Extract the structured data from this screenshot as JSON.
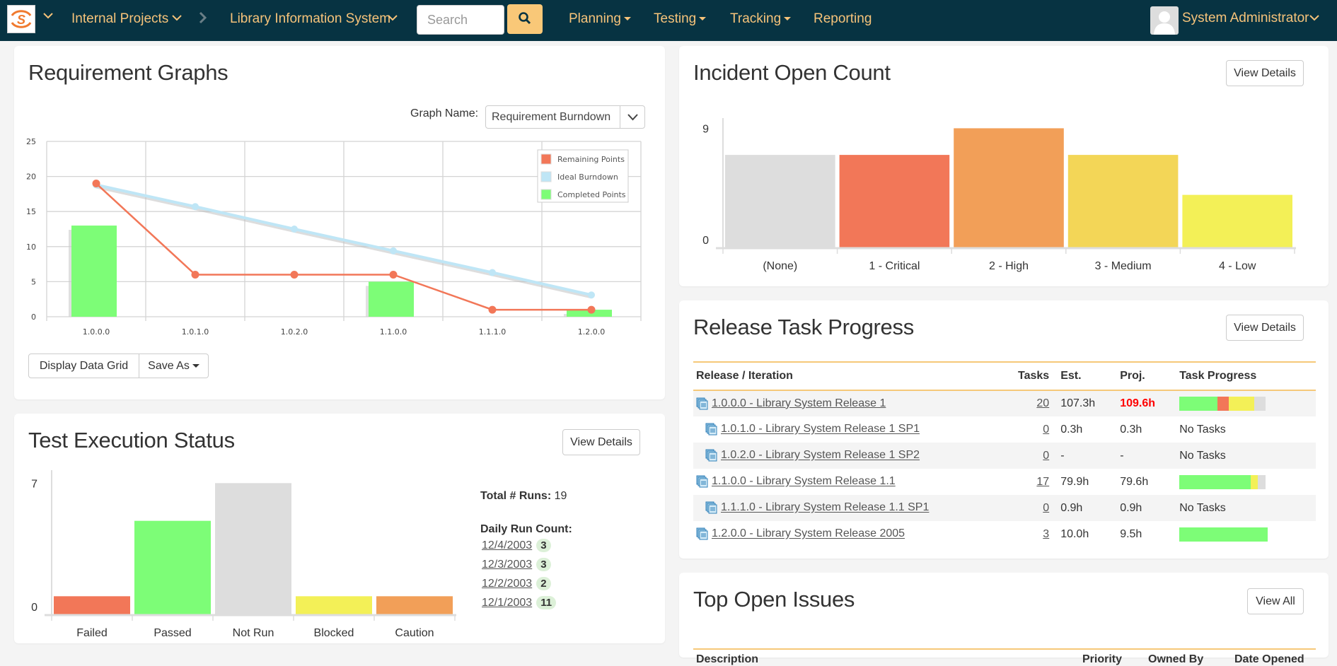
{
  "nav": {
    "project_group": "Internal Projects",
    "project": "Library Information System",
    "search_placeholder": "Search",
    "menu": [
      "Planning",
      "Testing",
      "Tracking",
      "Reporting"
    ],
    "user": "System Administrator"
  },
  "requirement_graphs": {
    "title": "Requirement Graphs",
    "graph_name_label": "Graph Name:",
    "graph_name_value": "Requirement Burndown",
    "display_grid_label": "Display Data Grid",
    "save_as_label": "Save As"
  },
  "incident_panel": {
    "title": "Incident Open Count",
    "view_details": "View Details"
  },
  "test_exec": {
    "title": "Test Execution Status",
    "view_details": "View Details",
    "total_runs_label": "Total # Runs:",
    "total_runs_value": "19",
    "daily_label": "Daily Run Count:",
    "daily": [
      {
        "date": "12/4/2003",
        "count": "3"
      },
      {
        "date": "12/3/2003",
        "count": "3"
      },
      {
        "date": "12/2/2003",
        "count": "2"
      },
      {
        "date": "12/1/2003",
        "count": "11"
      }
    ]
  },
  "release_progress": {
    "title": "Release Task Progress",
    "view_details": "View Details",
    "columns": [
      "Release / Iteration",
      "Tasks",
      "Est.",
      "Proj.",
      "Task Progress"
    ],
    "rows": [
      {
        "name": "1.0.0.0 - Library System Release 1",
        "indent": false,
        "tasks": "20",
        "est": "107.3h",
        "proj": "109.6h",
        "proj_overrun": true,
        "progress": {
          "completed": 44,
          "late": 13,
          "in_progress": 30,
          "not_started": 13
        }
      },
      {
        "name": "1.0.1.0 - Library System Release 1 SP1",
        "indent": true,
        "tasks": "0",
        "est": "0.3h",
        "proj": "0.3h",
        "no_tasks": "No Tasks"
      },
      {
        "name": "1.0.2.0 - Library System Release 1 SP2",
        "indent": true,
        "tasks": "0",
        "est": "-",
        "proj": "-",
        "no_tasks": "No Tasks"
      },
      {
        "name": "1.1.0.0 - Library System Release 1.1",
        "indent": false,
        "tasks": "17",
        "est": "79.9h",
        "proj": "79.6h",
        "progress": {
          "completed": 83,
          "late": 0,
          "in_progress": 8,
          "not_started": 9
        }
      },
      {
        "name": "1.1.1.0 - Library System Release 1.1 SP1",
        "indent": true,
        "tasks": "0",
        "est": "0.9h",
        "proj": "0.9h",
        "no_tasks": "No Tasks"
      },
      {
        "name": "1.2.0.0 - Library System Release 2005",
        "indent": false,
        "tasks": "3",
        "est": "10.0h",
        "proj": "9.5h",
        "progress": {
          "completed": 100,
          "late": 0,
          "in_progress": 0,
          "not_started": 0
        }
      }
    ]
  },
  "top_issues": {
    "title": "Top Open Issues",
    "view_all": "View All",
    "columns": [
      "Description",
      "Priority",
      "Owned By",
      "Date Opened"
    ]
  },
  "colors": {
    "nav_bg": "#073342",
    "nav_text": "#f6c37a",
    "remaining": "#f27758",
    "ideal": "#bfe6f6",
    "completed": "#7dfd77",
    "red": "#f27758",
    "orange": "#f29f58",
    "yellow_med": "#f3d657",
    "yellow": "#f3f057",
    "grey": "#dddddd",
    "overrun": "#ff0000"
  },
  "chart_data": [
    {
      "type": "bar+line",
      "title": "Requirement Burndown",
      "categories": [
        "1.0.0.0",
        "1.0.1.0",
        "1.0.2.0",
        "1.1.0.0",
        "1.1.1.0",
        "1.2.0.0"
      ],
      "series": [
        {
          "name": "Remaining Points",
          "kind": "line",
          "values": [
            19,
            6,
            6,
            6,
            1,
            1
          ]
        },
        {
          "name": "Ideal Burndown",
          "kind": "line",
          "values": [
            18.8,
            15.7,
            12.5,
            9.4,
            6.3,
            3.1
          ]
        },
        {
          "name": "Completed Points",
          "kind": "bar",
          "values": [
            13,
            0,
            0,
            5,
            0,
            1
          ]
        }
      ],
      "yticks": [
        0,
        5,
        10,
        15,
        20,
        25
      ],
      "ylim": [
        0,
        25
      ],
      "grid": true,
      "legend": "top-right"
    },
    {
      "type": "bar",
      "title": "Incident Open Count",
      "categories": [
        "(None)",
        "1 - Critical",
        "2 - High",
        "3 - Medium",
        "4 - Low"
      ],
      "values": [
        7,
        7,
        9,
        7,
        4
      ],
      "yticks": [
        0,
        9
      ],
      "ylim": [
        0,
        9.5
      ]
    },
    {
      "type": "bar",
      "title": "Test Execution Status",
      "categories": [
        "Failed",
        "Passed",
        "Not Run",
        "Blocked",
        "Caution"
      ],
      "values": [
        1,
        5,
        7,
        1,
        1
      ],
      "yticks": [
        0,
        7
      ],
      "ylim": [
        0,
        7.5
      ]
    }
  ]
}
